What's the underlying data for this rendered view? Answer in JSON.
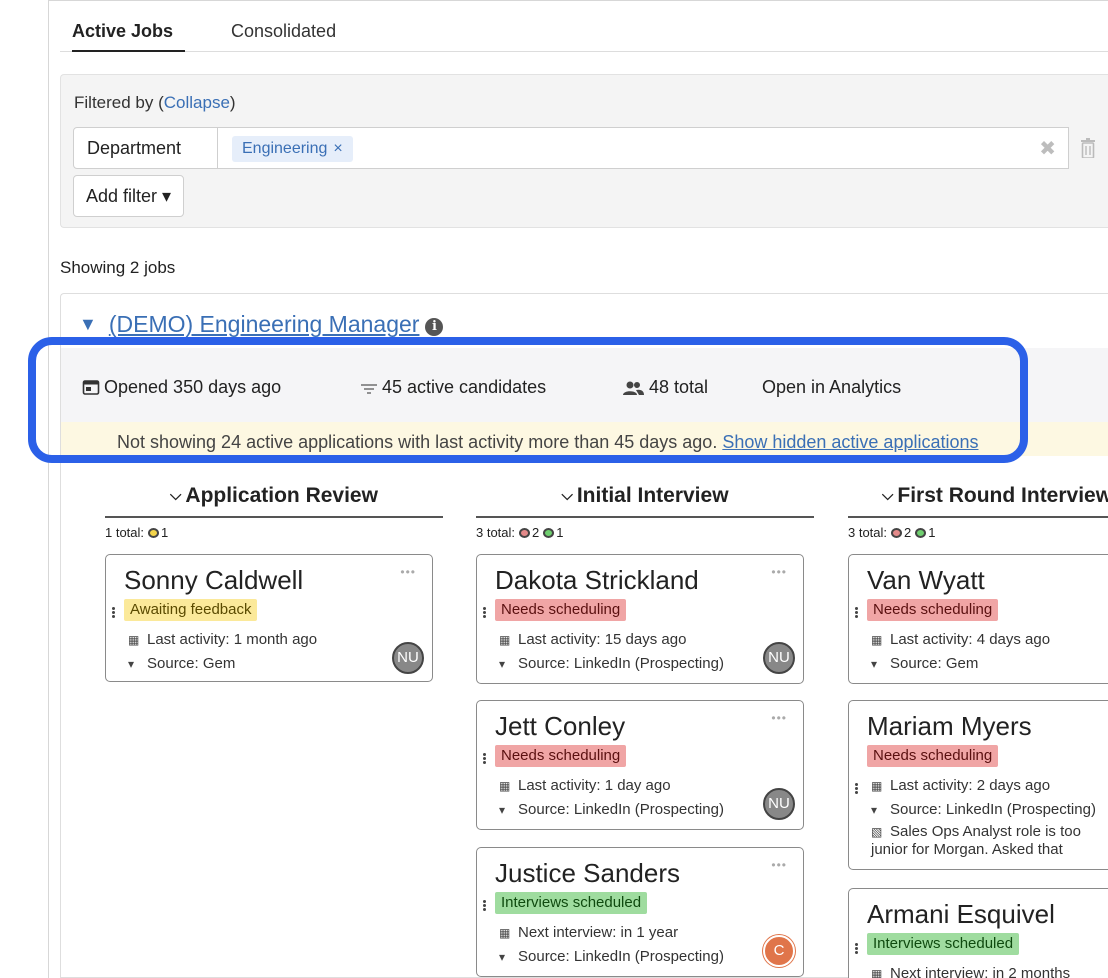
{
  "tabs": [
    {
      "label": "Active Jobs",
      "active": true
    },
    {
      "label": "Consolidated",
      "active": false
    }
  ],
  "filter": {
    "title_prefix": "Filtered by (",
    "collapse_link": "Collapse",
    "title_suffix": ")",
    "department_label": "Department",
    "chip_label": "Engineering",
    "chip_remove": "×",
    "clear_all": "✖",
    "add_filter": "Add filter ▾"
  },
  "showing": "Showing 2 jobs",
  "job": {
    "toggle": "▼",
    "title": "(DEMO) Engineering Manager",
    "info": "i",
    "opened": "Opened 350 days ago",
    "active_candidates": "45 active candidates",
    "total": "48 total",
    "analytics_link": "Open in Analytics",
    "notice_text": "Not showing 24 active applications with last activity more than 45 days ago. ",
    "notice_link": "Show hidden active applications"
  },
  "columns": [
    {
      "title": "Application Review",
      "summary_prefix": "1 total:",
      "summary": [
        {
          "color": "yellow",
          "count": "1"
        }
      ],
      "candidates": [
        {
          "name": "Sonny Caldwell",
          "status": "Awaiting feedback",
          "status_color": "yellow",
          "activity": "Last activity: 1 month ago",
          "source": "Source: Gem",
          "avatar": "NU",
          "avatar_color": "gray"
        }
      ]
    },
    {
      "title": "Initial Interview",
      "summary_prefix": "3 total:",
      "summary": [
        {
          "color": "red",
          "count": "2"
        },
        {
          "color": "green",
          "count": "1"
        }
      ],
      "candidates": [
        {
          "name": "Dakota Strickland",
          "status": "Needs scheduling",
          "status_color": "red",
          "activity": "Last activity: 15 days ago",
          "source": "Source: LinkedIn (Prospecting)",
          "avatar": "NU",
          "avatar_color": "gray"
        },
        {
          "name": "Jett Conley",
          "status": "Needs scheduling",
          "status_color": "red",
          "activity": "Last activity: 1 day ago",
          "source": "Source: LinkedIn (Prospecting)",
          "avatar": "NU",
          "avatar_color": "gray"
        },
        {
          "name": "Justice Sanders",
          "status": "Interviews scheduled",
          "status_color": "green",
          "activity": "Next interview: in 1 year",
          "source": "Source: LinkedIn (Prospecting)",
          "avatar": "C",
          "avatar_color": "orange"
        }
      ]
    },
    {
      "title": "First Round Interview",
      "summary_prefix": "3 total:",
      "summary": [
        {
          "color": "red",
          "count": "2"
        },
        {
          "color": "green",
          "count": "1"
        }
      ],
      "candidates": [
        {
          "name": "Van Wyatt",
          "status": "Needs scheduling",
          "status_color": "red",
          "activity": "Last activity: 4 days ago",
          "source": "Source: Gem"
        },
        {
          "name": "Mariam Myers",
          "status": "Needs scheduling",
          "status_color": "red",
          "activity": "Last activity: 2 days ago",
          "source": "Source: LinkedIn (Prospecting)",
          "note": "Sales Ops Analyst role is too junior for Morgan. Asked that"
        },
        {
          "name": "Armani Esquivel",
          "status": "Interviews scheduled",
          "status_color": "green",
          "activity": "Next interview: in 2 months"
        }
      ]
    }
  ],
  "colors": {
    "accent": "#3a6fb5",
    "highlight": "#2b60e8",
    "notice_bg": "#fdf8e2"
  }
}
